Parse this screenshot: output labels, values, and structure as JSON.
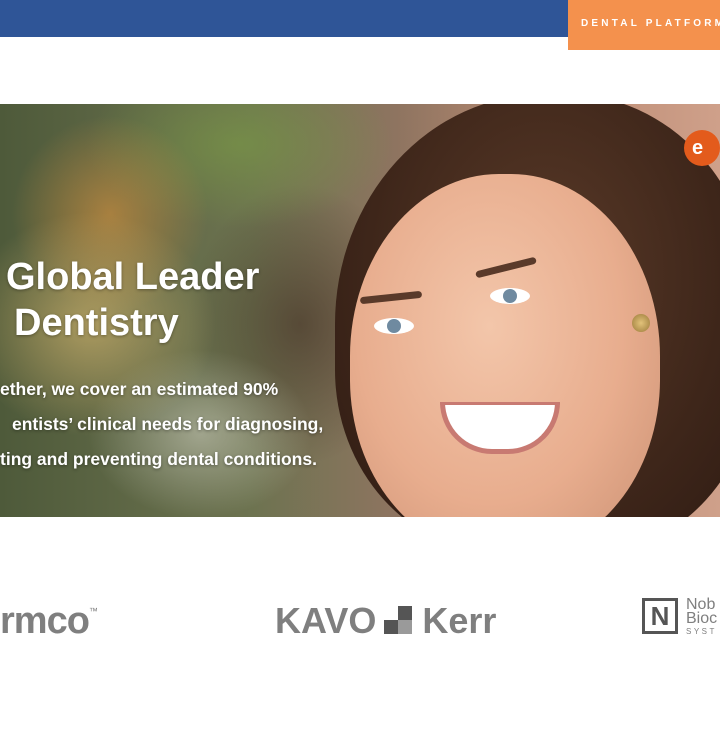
{
  "header": {
    "tab_label": "DENTAL PLATFORM",
    "bar_color": "#2f5597",
    "tab_color": "#f4914d"
  },
  "hero": {
    "title_line1": "Global Leader",
    "title_line2": "Dentistry",
    "body_line1": "ether, we cover an estimated 90%",
    "body_line2": "entists’ clinical needs for diagnosing,",
    "body_line3": "ting and preventing dental conditions.",
    "brand_mark": "e"
  },
  "logos": {
    "ormco": "rmco",
    "ormco_tm": "™",
    "kavo": "KAVO",
    "kerr": "Kerr",
    "nobel_mark": "N",
    "nobel_line1": "Nob",
    "nobel_line2": "Bioc",
    "nobel_line3": "SYST"
  }
}
